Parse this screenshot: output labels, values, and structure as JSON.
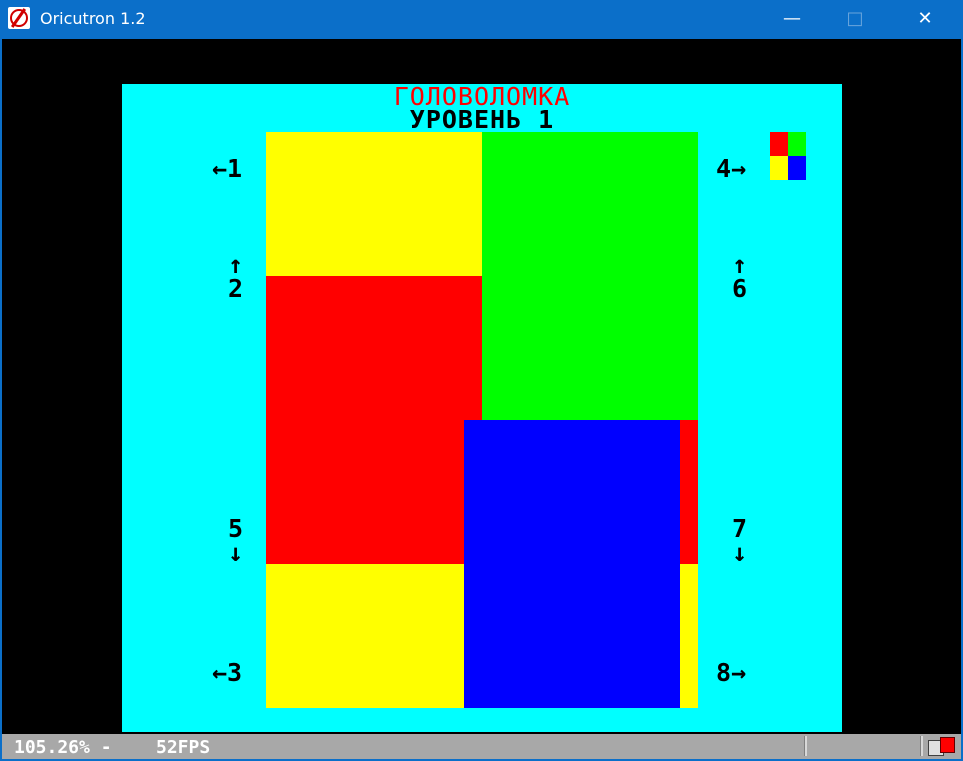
{
  "window": {
    "title": "Oricutron 1.2",
    "minimize_icon": "minimize-icon",
    "maximize_icon": "maximize-icon",
    "close_icon": "close-icon"
  },
  "game": {
    "title": "ГОЛОВОЛОМКА",
    "level": "УРОВЕНЬ 1",
    "colors": {
      "background": "#00ffff",
      "title": "#ff0000",
      "yellow": "#ffff00",
      "green": "#00ff00",
      "red": "#ff0000",
      "blue": "#0000ff"
    },
    "controls": {
      "c1": "←1",
      "c2_arrow": "↑",
      "c2_num": "2",
      "c3": "←3",
      "c4": "4→",
      "c5_num": "5",
      "c5_arrow": "↓",
      "c6_arrow": "↑",
      "c6_num": "6",
      "c7_num": "7",
      "c7_arrow": "↓",
      "c8": "8→"
    },
    "preview_colors": [
      "#ff0000",
      "#00ff00",
      "#ffff00",
      "#0000ff"
    ]
  },
  "status": {
    "zoom": "105.26% -",
    "fps": "52FPS"
  }
}
